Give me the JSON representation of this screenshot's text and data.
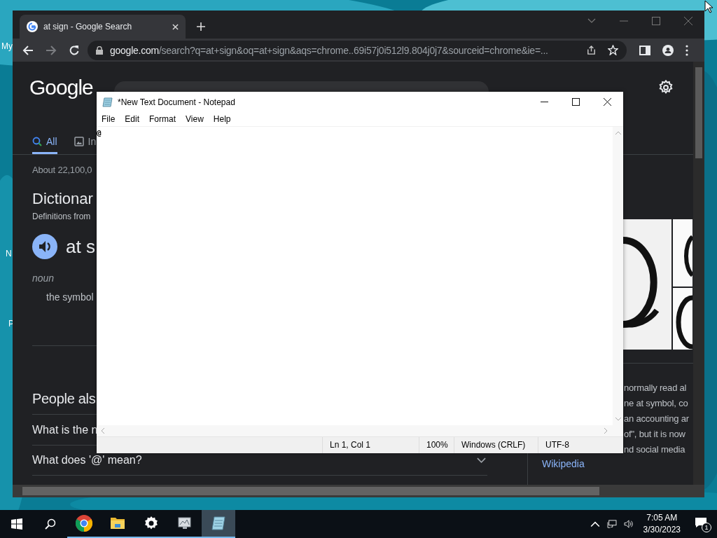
{
  "desktop": {
    "icon_labels": [
      "My",
      "N",
      "P"
    ]
  },
  "browser": {
    "tab": {
      "title": "at sign - Google Search"
    },
    "address": {
      "domain": "google.com",
      "path": "/search?q=at+sign&oq=at+sign&aqs=chrome..69i57j0i512l9.804j0j7&sourceid=chrome&ie=..."
    }
  },
  "google": {
    "logo": "Google",
    "tabs": [
      {
        "label": "All",
        "selected": true
      },
      {
        "label": "In",
        "selected": false
      }
    ],
    "result_stats": "About 22,100,0",
    "dictionary": {
      "heading": "Dictionar",
      "source": "Definitions from",
      "word": "at s",
      "part_of_speech": "noun",
      "definition": "the symbol"
    },
    "people_also_ask": {
      "heading": "People als",
      "questions": [
        "What is the n",
        "What does '@' mean?"
      ]
    },
    "knowledge_panel": {
      "description_lines": [
        "normally read al",
        "ne at symbol, co",
        "an accounting ar",
        "of\", but it is now",
        "nd social media"
      ],
      "source_link": "Wikipedia"
    }
  },
  "notepad": {
    "title": "*New Text Document - Notepad",
    "menu": [
      "File",
      "Edit",
      "Format",
      "View",
      "Help"
    ],
    "content": "@",
    "status": {
      "position": "Ln 1, Col 1",
      "zoom": "100%",
      "line_endings": "Windows (CRLF)",
      "encoding": "UTF-8"
    }
  },
  "taskbar": {
    "apps": [
      {
        "kind": "chrome",
        "active": false
      },
      {
        "kind": "explorer",
        "active": false
      },
      {
        "kind": "settings",
        "active": false
      },
      {
        "kind": "monitor",
        "active": false
      },
      {
        "kind": "notepad",
        "active": true
      }
    ],
    "time": "7:05 AM",
    "date": "3/30/2023",
    "notification_count": "1"
  }
}
